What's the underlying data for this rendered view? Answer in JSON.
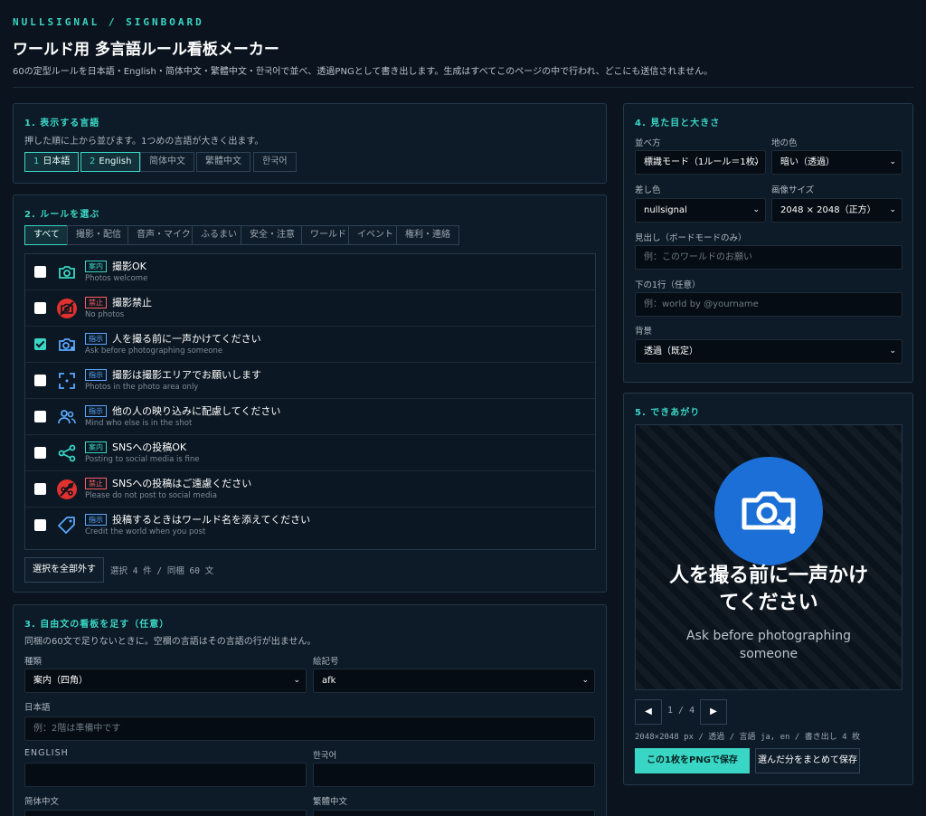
{
  "header": {
    "brand": "NULLSIGNAL / SIGNBOARD",
    "title": "ワールド用 多言語ルール看板メーカー",
    "subtitle": "60の定型ルールを日本語・English・简体中文・繁體中文・한국어で並べ、透過PNGとして書き出します。生成はすべてこのページの中で行われ、どこにも送信されません。"
  },
  "languages": {
    "title": "1. 表示する言語",
    "note": "押した順に上から並びます。1つめの言語が大きく出ます。",
    "items": [
      {
        "num": "1",
        "label": "日本語"
      },
      {
        "num": "2",
        "label": "English"
      },
      {
        "num": "",
        "label": "简体中文"
      },
      {
        "num": "",
        "label": "繁體中文"
      },
      {
        "num": "",
        "label": "한국어"
      }
    ]
  },
  "rules": {
    "title": "2. ルールを選ぶ",
    "categories": [
      "すべて",
      "撮影・配信",
      "音声・マイク",
      "ふるまい",
      "安全・注意",
      "ワールド",
      "イベント",
      "権利・連絡"
    ],
    "items": [
      {
        "tag": "案内",
        "ja": "撮影OK",
        "en": "Photos welcome",
        "checked": false,
        "icon": "camera-icon"
      },
      {
        "tag": "禁止",
        "ja": "撮影禁止",
        "en": "No photos",
        "checked": false,
        "icon": "no-camera-icon"
      },
      {
        "tag": "指示",
        "ja": "人を撮る前に一声かけてください",
        "en": "Ask before photographing someone",
        "checked": true,
        "icon": "camera-ask-icon"
      },
      {
        "tag": "指示",
        "ja": "撮影は撮影エリアでお願いします",
        "en": "Photos in the photo area only",
        "checked": false,
        "icon": "frame-icon"
      },
      {
        "tag": "指示",
        "ja": "他の人の映り込みに配慮してください",
        "en": "Mind who else is in the shot",
        "checked": false,
        "icon": "people-icon"
      },
      {
        "tag": "案内",
        "ja": "SNSへの投稿OK",
        "en": "Posting to social media is fine",
        "checked": false,
        "icon": "share-icon"
      },
      {
        "tag": "禁止",
        "ja": "SNSへの投稿はご遠慮ください",
        "en": "Please do not post to social media",
        "checked": false,
        "icon": "no-share-icon"
      },
      {
        "tag": "指示",
        "ja": "投稿するときはワールド名を添えてください",
        "en": "Credit the world when you post",
        "checked": false,
        "icon": "tag-icon"
      }
    ],
    "clear_label": "選択を全部外す",
    "status": "選択 4 件 / 同梱 60 文"
  },
  "custom": {
    "title": "3. 自由文の看板を足す（任意）",
    "note": "同梱の60文で足りないときに。空欄の言語はその言語の行が出ません。",
    "type_label": "種類",
    "type_value": "案内（四角）",
    "symbol_label": "絵記号",
    "symbol_value": "afk",
    "ja_label": "日本語",
    "ja_placeholder": "例：2階は準備中です",
    "en_label": "ENGLISH",
    "ko_label": "한국어",
    "zhs_label": "简体中文",
    "zht_label": "繁體中文"
  },
  "appearance": {
    "title": "4. 見た目と大きさ",
    "layout_label": "並べ方",
    "layout_value": "標識モード（1ルール＝1枚）",
    "bg_label": "地の色",
    "bg_value": "暗い（透過）",
    "accent_label": "差し色",
    "accent_value": "nullsignal",
    "size_label": "画像サイズ",
    "size_value": "2048 × 2048（正方）",
    "heading_label": "見出し（ボードモードのみ）",
    "heading_placeholder": "例：このワールドのお願い",
    "footer_label": "下の1行（任意）",
    "footer_placeholder": "例：world by @yourname",
    "background_label": "背景",
    "background_value": "透過（既定）"
  },
  "result": {
    "title": "5. できあがり",
    "preview_ja": "人を撮る前に一声かけてください",
    "preview_en": "Ask before photographing someone",
    "page": "1 / 4",
    "prev": "◀",
    "next": "▶",
    "info": "2048×2048 px / 透過 / 言語 ja, en / 書き出し 4 枚",
    "save_one": "この1枚をPNGで保存",
    "save_all": "選んだ分をまとめて保存"
  },
  "colors": {
    "accent": "#3ad6c5",
    "prohibit": "#ff5d5d",
    "instruction": "#5aa8ff",
    "preview_circle": "#1c6fd6"
  }
}
